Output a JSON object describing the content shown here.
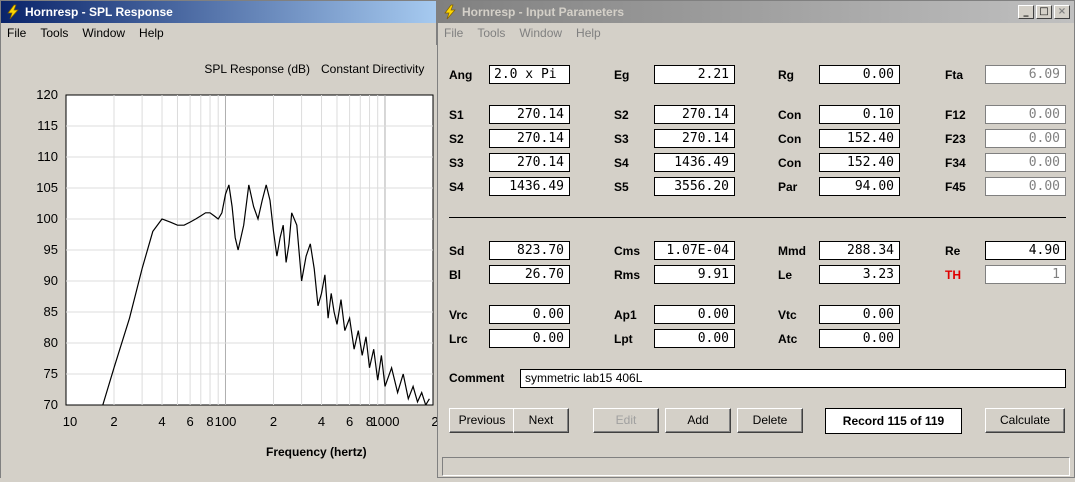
{
  "spl_window": {
    "title": "Hornresp - SPL Response",
    "menu": [
      "File",
      "Tools",
      "Window",
      "Help"
    ],
    "chart_title": "SPL Response (dB)",
    "chart_mode": "Constant Directivity",
    "xlabel": "Frequency (hertz)",
    "y_ticks": [
      "120",
      "115",
      "110",
      "105",
      "100",
      "95",
      "90",
      "85",
      "80",
      "75",
      "70"
    ],
    "x_ticks": [
      "10",
      "2",
      "4",
      "6",
      "8",
      "100",
      "2",
      "4",
      "6",
      "8",
      "1000",
      "2"
    ]
  },
  "chart_data": {
    "type": "line",
    "title": "SPL Response (dB)",
    "xlabel": "Frequency (hertz)",
    "ylabel": "",
    "x_scale": "log",
    "xlim": [
      10,
      2000
    ],
    "ylim": [
      70,
      120
    ],
    "grid": true,
    "series": [
      {
        "x": [
          17,
          20,
          25,
          30,
          35,
          40,
          45,
          50,
          55,
          60,
          65,
          70,
          75,
          80,
          85,
          90,
          95,
          100,
          105,
          110,
          115,
          120,
          130,
          140,
          150,
          160,
          170,
          180,
          190,
          200,
          210,
          220,
          230,
          240,
          250,
          260,
          280,
          300,
          320,
          340,
          360,
          380,
          400,
          420,
          440,
          460,
          480,
          500,
          530,
          560,
          600,
          640,
          680,
          720,
          760,
          800,
          850,
          900,
          950,
          1000,
          1100,
          1200,
          1300,
          1400,
          1500,
          1600,
          1700,
          1800,
          1900
        ],
        "values": [
          70,
          76,
          84,
          92,
          98,
          100,
          99.5,
          99,
          99,
          99.5,
          100,
          100.5,
          101,
          101,
          100.5,
          100,
          101,
          104,
          105.5,
          102,
          97,
          95,
          99,
          105.5,
          102,
          100,
          103,
          105.5,
          103,
          98,
          94,
          97,
          99,
          93,
          96,
          101,
          99,
          90,
          94,
          96,
          92,
          86,
          88,
          91,
          84,
          88,
          85,
          83,
          87,
          82,
          84,
          79,
          82,
          78,
          81,
          76,
          79,
          74,
          78,
          73,
          76,
          72,
          75,
          71,
          73,
          70.5,
          72,
          70,
          71
        ]
      }
    ]
  },
  "input_window": {
    "title": "Hornresp - Input Parameters",
    "menu": [
      "File",
      "Tools",
      "Window",
      "Help"
    ],
    "rows_top": [
      [
        {
          "label": "Ang",
          "value": "2.0 x Pi",
          "left": true
        },
        {
          "label": "Eg",
          "value": "2.21"
        },
        {
          "label": "Rg",
          "value": "0.00"
        },
        {
          "label": "Fta",
          "value": "6.09",
          "dim": true
        }
      ],
      [
        {
          "label": "S1",
          "value": "270.14"
        },
        {
          "label": "S2",
          "value": "270.14"
        },
        {
          "label": "Con",
          "value": "0.10"
        },
        {
          "label": "F12",
          "value": "0.00",
          "dim": true
        }
      ],
      [
        {
          "label": "S2",
          "value": "270.14"
        },
        {
          "label": "S3",
          "value": "270.14"
        },
        {
          "label": "Con",
          "value": "152.40"
        },
        {
          "label": "F23",
          "value": "0.00",
          "dim": true
        }
      ],
      [
        {
          "label": "S3",
          "value": "270.14"
        },
        {
          "label": "S4",
          "value": "1436.49"
        },
        {
          "label": "Con",
          "value": "152.40"
        },
        {
          "label": "F34",
          "value": "0.00",
          "dim": true
        }
      ],
      [
        {
          "label": "S4",
          "value": "1436.49"
        },
        {
          "label": "S5",
          "value": "3556.20"
        },
        {
          "label": "Par",
          "value": "94.00"
        },
        {
          "label": "F45",
          "value": "0.00",
          "dim": true
        }
      ]
    ],
    "rows_bottom": [
      [
        {
          "label": "Sd",
          "value": "823.70"
        },
        {
          "label": "Cms",
          "value": "1.07E-04"
        },
        {
          "label": "Mmd",
          "value": "288.34"
        },
        {
          "label": "Re",
          "value": "4.90"
        }
      ],
      [
        {
          "label": "Bl",
          "value": "26.70"
        },
        {
          "label": "Rms",
          "value": "9.91"
        },
        {
          "label": "Le",
          "value": "3.23"
        },
        {
          "label": "TH",
          "value": "1",
          "dim": true,
          "red": true
        }
      ],
      [
        {
          "label": "Vrc",
          "value": "0.00"
        },
        {
          "label": "Ap1",
          "value": "0.00"
        },
        {
          "label": "Vtc",
          "value": "0.00"
        }
      ],
      [
        {
          "label": "Lrc",
          "value": "0.00"
        },
        {
          "label": "Lpt",
          "value": "0.00"
        },
        {
          "label": "Atc",
          "value": "0.00"
        }
      ]
    ],
    "comment_label": "Comment",
    "comment_value": "symmetric lab15 406L",
    "buttons": {
      "previous": "Previous",
      "next": "Next",
      "edit": "Edit",
      "add": "Add",
      "delete": "Delete",
      "record": "Record 115 of 119",
      "calculate": "Calculate"
    }
  }
}
